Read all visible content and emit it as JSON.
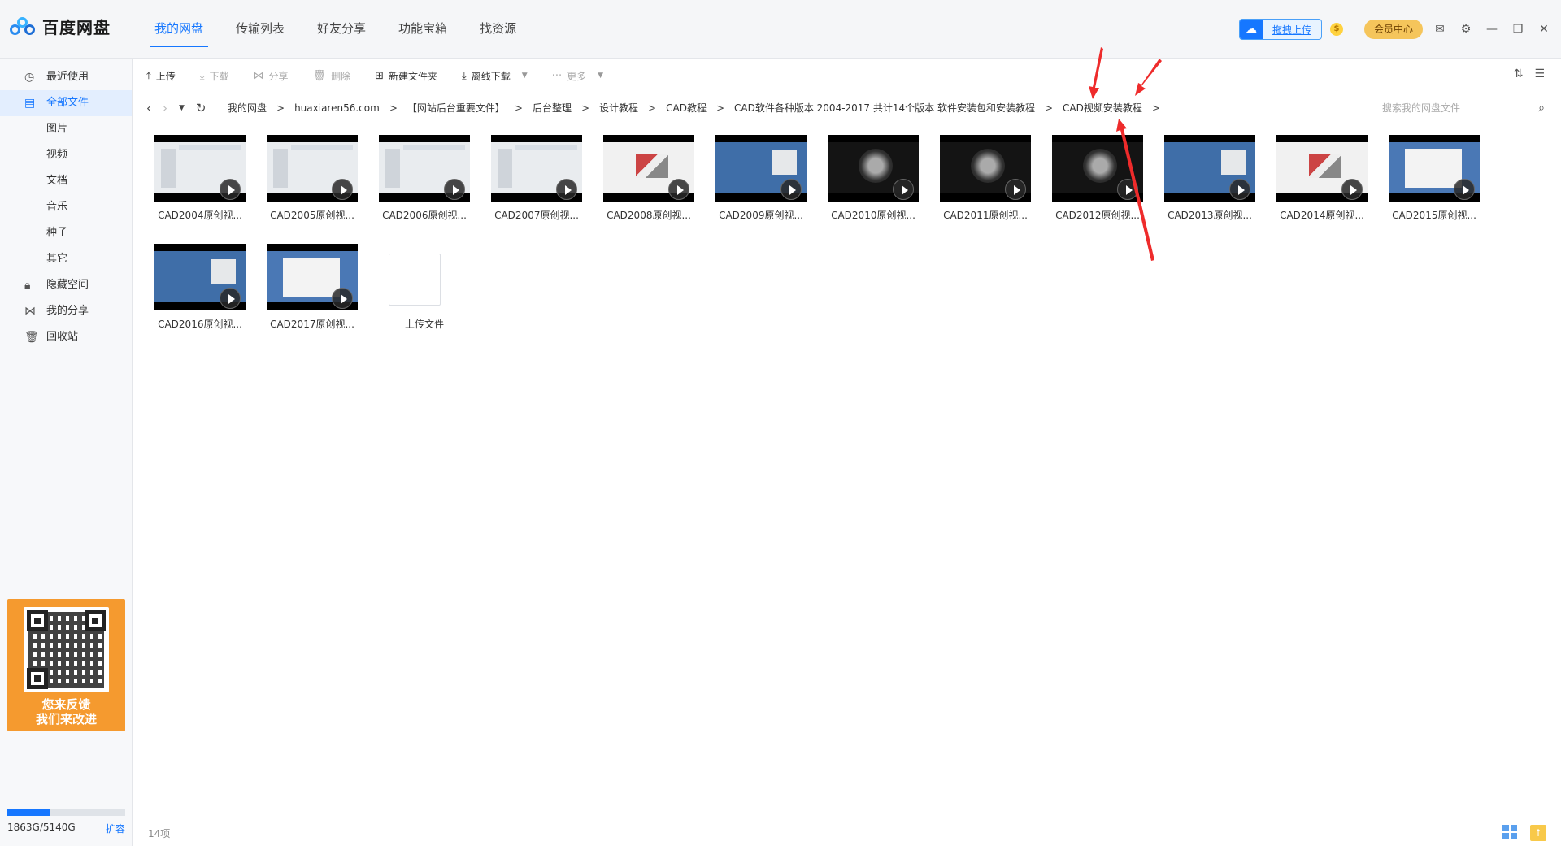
{
  "app": {
    "name": "百度网盘"
  },
  "nav": [
    {
      "label": "我的网盘",
      "active": true
    },
    {
      "label": "传输列表"
    },
    {
      "label": "好友分享"
    },
    {
      "label": "功能宝箱"
    },
    {
      "label": "找资源"
    }
  ],
  "titlebar": {
    "drag_upload_label": "拖拽上传",
    "coin_icon": "coin-icon",
    "vip_label": "会员中心"
  },
  "sidebar": {
    "items": [
      {
        "label": "最近使用",
        "icon": "clock-icon"
      },
      {
        "label": "全部文件",
        "icon": "file-icon",
        "active": true
      },
      {
        "label": "图片"
      },
      {
        "label": "视频"
      },
      {
        "label": "文档"
      },
      {
        "label": "音乐"
      },
      {
        "label": "种子"
      },
      {
        "label": "其它"
      },
      {
        "label": "隐藏空间",
        "icon": "lock-icon"
      },
      {
        "label": "我的分享",
        "icon": "share-icon"
      },
      {
        "label": "回收站",
        "icon": "trash-icon"
      }
    ],
    "feedback_line1": "您来反馈",
    "feedback_line2": "我们来改进",
    "storage": "1863G/5140G",
    "storage_fraction": 0.36,
    "expand_label": "扩容"
  },
  "toolbar": {
    "upload": "上传",
    "download": "下载",
    "share": "分享",
    "delete": "删除",
    "new_folder": "新建文件夹",
    "offline_download": "离线下载",
    "more": "更多"
  },
  "breadcrumb": [
    "我的网盘",
    "huaxiaren56.com",
    "【网站后台重要文件】",
    "后台整理",
    "设计教程",
    "CAD教程",
    "CAD软件各种版本 2004-2017 共计14个版本 软件安装包和安装教程",
    "CAD视频安装教程"
  ],
  "search": {
    "placeholder": "搜索我的网盘文件"
  },
  "files": [
    {
      "name": "CAD2004原创视...",
      "thumb": "win"
    },
    {
      "name": "CAD2005原创视...",
      "thumb": "win"
    },
    {
      "name": "CAD2006原创视...",
      "thumb": "win"
    },
    {
      "name": "CAD2007原创视...",
      "thumb": "win"
    },
    {
      "name": "CAD2008原创视...",
      "thumb": "render"
    },
    {
      "name": "CAD2009原创视...",
      "thumb": "blue"
    },
    {
      "name": "CAD2010原创视...",
      "thumb": "dark"
    },
    {
      "name": "CAD2011原创视...",
      "thumb": "dark"
    },
    {
      "name": "CAD2012原创视...",
      "thumb": "dark"
    },
    {
      "name": "CAD2013原创视...",
      "thumb": "blue"
    },
    {
      "name": "CAD2014原创视...",
      "thumb": "render"
    },
    {
      "name": "CAD2015原创视...",
      "thumb": "bluewin"
    },
    {
      "name": "CAD2016原创视...",
      "thumb": "blue"
    },
    {
      "name": "CAD2017原创视...",
      "thumb": "bluewin"
    }
  ],
  "upload_tile_label": "上传文件",
  "status": {
    "count": "14项"
  }
}
